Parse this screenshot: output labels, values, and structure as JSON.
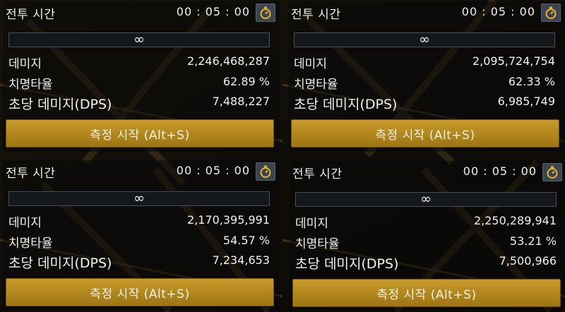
{
  "colors": {
    "button_gold": "#b58a20",
    "timer_button_bg": "#3b4450",
    "background": "#0c0a07"
  },
  "panels": [
    {
      "title": "전투 시간",
      "time": "00 : 05 : 00",
      "timer_icon": "stopwatch-icon",
      "progress_text": "∞",
      "stats": [
        {
          "label": "데미지",
          "value": "2,246,468,287"
        },
        {
          "label": "치명타율",
          "value": "62.89 %"
        },
        {
          "label": "초당 데미지(DPS)",
          "value": "7,488,227"
        }
      ],
      "button_label": "측정 시작 (Alt+S)"
    },
    {
      "title": "전투 시간",
      "time": "00 : 05 : 00",
      "timer_icon": "stopwatch-icon",
      "progress_text": "∞",
      "stats": [
        {
          "label": "데미지",
          "value": "2,095,724,754"
        },
        {
          "label": "치명타율",
          "value": "62.33 %"
        },
        {
          "label": "초당 데미지(DPS)",
          "value": "6,985,749"
        }
      ],
      "button_label": "측정 시작 (Alt+S)"
    },
    {
      "title": "전투 시간",
      "time": "00 : 05 : 00",
      "timer_icon": "stopwatch-icon",
      "progress_text": "∞",
      "stats": [
        {
          "label": "데미지",
          "value": "2,170,395,991"
        },
        {
          "label": "치명타율",
          "value": "54.57 %"
        },
        {
          "label": "초당 데미지(DPS)",
          "value": "7,234,653"
        }
      ],
      "button_label": "측정 시작 (Alt+S)"
    },
    {
      "title": "전투 시간",
      "time": "00 : 05 : 00",
      "timer_icon": "stopwatch-icon",
      "progress_text": "∞",
      "stats": [
        {
          "label": "데미지",
          "value": "2,250,289,941"
        },
        {
          "label": "치명타율",
          "value": "53.21 %"
        },
        {
          "label": "초당 데미지(DPS)",
          "value": "7,500,966"
        }
      ],
      "button_label": "측정 시작 (Alt+S)"
    }
  ]
}
